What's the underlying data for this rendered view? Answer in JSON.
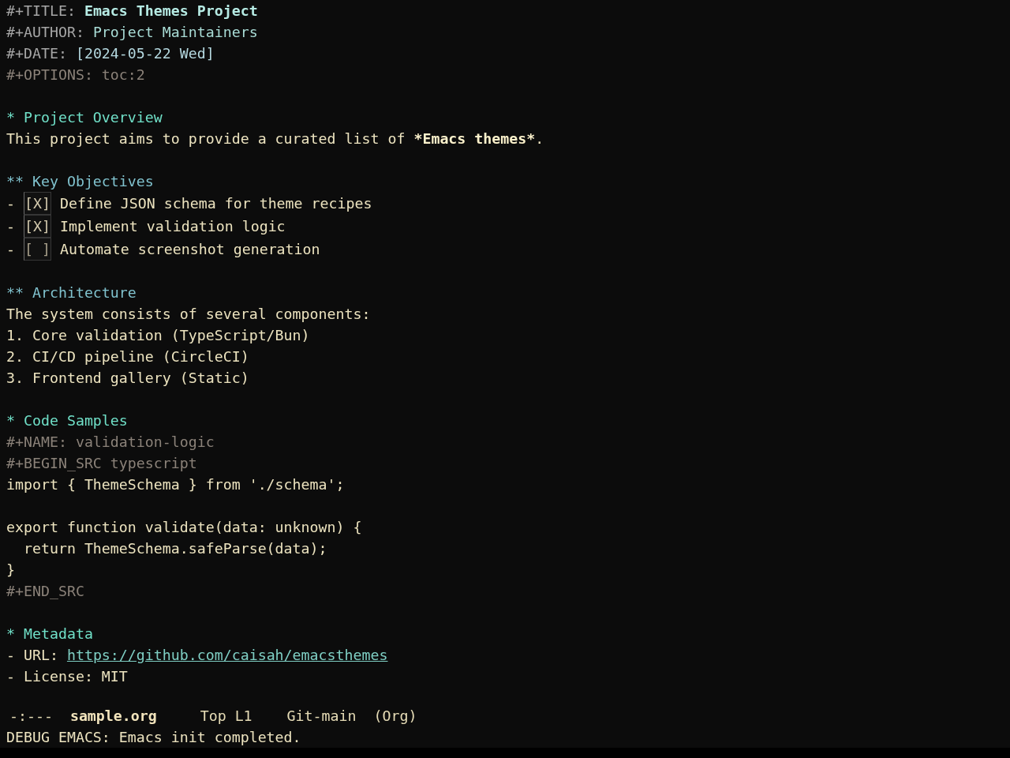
{
  "keywords": [
    {
      "kind": "title",
      "key": "#+TITLE:",
      "value": "Emacs Themes Project"
    },
    {
      "kind": "author",
      "key": "#+AUTHOR:",
      "value": "Project Maintainers"
    },
    {
      "kind": "date",
      "key": "#+DATE:",
      "value": "[2024-05-22 Wed]"
    },
    {
      "kind": "option",
      "key": "#+OPTIONS:",
      "value": "toc:2"
    }
  ],
  "sections": [
    {
      "heading": "* Project Overview",
      "body": [
        {
          "kind": "paragraph",
          "parts": [
            {
              "text": "This project aims to provide a curated list of ",
              "bold": false
            },
            {
              "text": "*Emacs themes*",
              "bold": true
            },
            {
              "text": ".",
              "bold": false
            }
          ]
        }
      ],
      "children": [
        {
          "heading": "** Key Objectives",
          "body": [
            {
              "kind": "checkbox_item",
              "bullet": "-",
              "checkbox": "[X]",
              "checked": true,
              "text": "Define JSON schema for theme recipes"
            },
            {
              "kind": "checkbox_item",
              "bullet": "-",
              "checkbox": "[X]",
              "checked": true,
              "text": "Implement validation logic"
            },
            {
              "kind": "checkbox_item",
              "bullet": "-",
              "checkbox": "[ ]",
              "checked": false,
              "text": "Automate screenshot generation"
            }
          ]
        },
        {
          "heading": "** Architecture",
          "body": [
            {
              "kind": "text",
              "text": "The system consists of several components:"
            },
            {
              "kind": "ordered_item",
              "text": "1. Core validation (TypeScript/Bun)"
            },
            {
              "kind": "ordered_item",
              "text": "2. CI/CD pipeline (CircleCI)"
            },
            {
              "kind": "ordered_item",
              "text": "3. Frontend gallery (Static)"
            }
          ]
        }
      ]
    },
    {
      "heading": "* Code Samples",
      "body": [
        {
          "kind": "meta_line",
          "text": "#+NAME: validation-logic"
        },
        {
          "kind": "meta_line",
          "text": "#+BEGIN_SRC typescript"
        },
        {
          "kind": "code",
          "text": "import { ThemeSchema } from './schema';\n\nexport function validate(data: unknown) {\n  return ThemeSchema.safeParse(data);\n}"
        },
        {
          "kind": "meta_line",
          "text": "#+END_SRC"
        }
      ]
    },
    {
      "heading": "* Metadata",
      "body": [
        {
          "kind": "link_item",
          "label": "- URL:",
          "link": "https://github.com/caisah/emacsthemes"
        },
        {
          "kind": "text",
          "text": "- License: MIT"
        }
      ]
    }
  ],
  "mode_line": {
    "status": "-:---",
    "buffer_name": "sample.org",
    "position": "Top L1",
    "vc": "Git-main",
    "mode": "(Org)"
  },
  "echo_area": {
    "message": "DEBUG EMACS: Emacs init completed."
  }
}
